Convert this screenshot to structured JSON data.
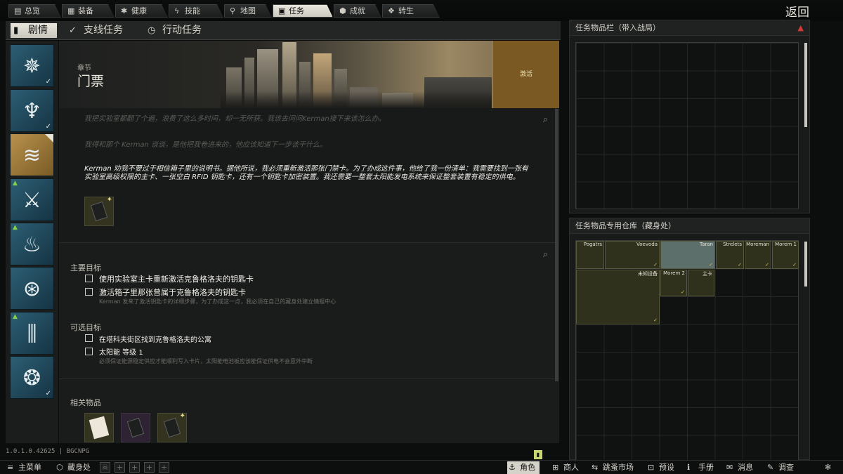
{
  "top_nav": {
    "tabs": [
      {
        "label": "总览",
        "icon": "bars-icon"
      },
      {
        "label": "装备",
        "icon": "shirt-icon"
      },
      {
        "label": "健康",
        "icon": "health-icon"
      },
      {
        "label": "技能",
        "icon": "bolt-icon"
      },
      {
        "label": "地图",
        "icon": "map-pin-icon"
      },
      {
        "label": "任务",
        "icon": "clipboard-icon"
      },
      {
        "label": "成就",
        "icon": "achievement-icon"
      },
      {
        "label": "转生",
        "icon": "prestige-icon"
      }
    ],
    "back_label": "返回"
  },
  "sub_tabs": [
    {
      "label": "剧情",
      "icon": "story-icon"
    },
    {
      "label": "支线任务",
      "icon": "check-circle-icon"
    },
    {
      "label": "行动任务",
      "icon": "clock-icon"
    }
  ],
  "quest": {
    "chapter_kicker": "章节",
    "title": "门票",
    "activate_label": "激活",
    "paragraphs": [
      "我把实验室都翻了个遍，浪费了这么多时间，却一无所获。我该去问问Kerman接下来该怎么办。",
      "我得和那个 Kerman 谈谈，是他把我卷进来的，他应该知道下一步该干什么。",
      "Kerman 劝我不要过于相信箱子里的说明书。据他所说，我必须重新激活那张门禁卡。为了办成这件事，他给了我一份清单：我需要找到一张有实验室高级权限的主卡、一张空白 RFID 钥匙卡，还有一个钥匙卡加密装置。我还需要一整套太阳能发电系统来保证整套装置有稳定的供电。"
    ],
    "main_objectives_header": "主要目标",
    "main_objectives": [
      "使用实验室主卡重新激活克鲁格洛夫的钥匙卡",
      "激活箱子里那张曾属于克鲁格洛夫的钥匙卡"
    ],
    "main_objectives_note": "Kerman 发来了激活钥匙卡的详细步骤，为了办成这一点，我必须在自己的藏身处建立情报中心",
    "optional_header": "可选目标",
    "optional_objectives": [
      "在塔科夫街区找到克鲁格洛夫的公寓",
      "太阳能 等级 1"
    ],
    "optional_note": "必须保证能源稳定供应才能顺利写入卡片，太阳能电池板应该能保证供电不会意外中断",
    "related_header": "相关物品"
  },
  "right_panel": {
    "quest_items_header": "任务物品栏（带入战局）",
    "stash_header": "任务物品专用仓库（藏身处）",
    "stash_items": [
      "Pogatrs",
      "Voevoda",
      "Taran",
      "Strelets",
      "Moreman",
      "Morem 1",
      "未知设备",
      "Morem 2",
      "主卡"
    ]
  },
  "footer": {
    "version": "1.0.1.0.42625 | BGCNPG",
    "left_buttons": [
      {
        "label": "主菜单",
        "icon": "menu-icon"
      },
      {
        "label": "藏身处",
        "icon": "hideout-icon"
      }
    ],
    "right_buttons": [
      {
        "label": "角色",
        "icon": "character-icon"
      },
      {
        "label": "商人",
        "icon": "cart-icon"
      },
      {
        "label": "跳蚤市场",
        "icon": "flea-market-icon"
      },
      {
        "label": "预设",
        "icon": "preset-icon"
      },
      {
        "label": "手册",
        "icon": "handbook-icon"
      },
      {
        "label": "消息",
        "icon": "message-icon"
      },
      {
        "label": "调查",
        "icon": "survey-icon"
      }
    ]
  }
}
